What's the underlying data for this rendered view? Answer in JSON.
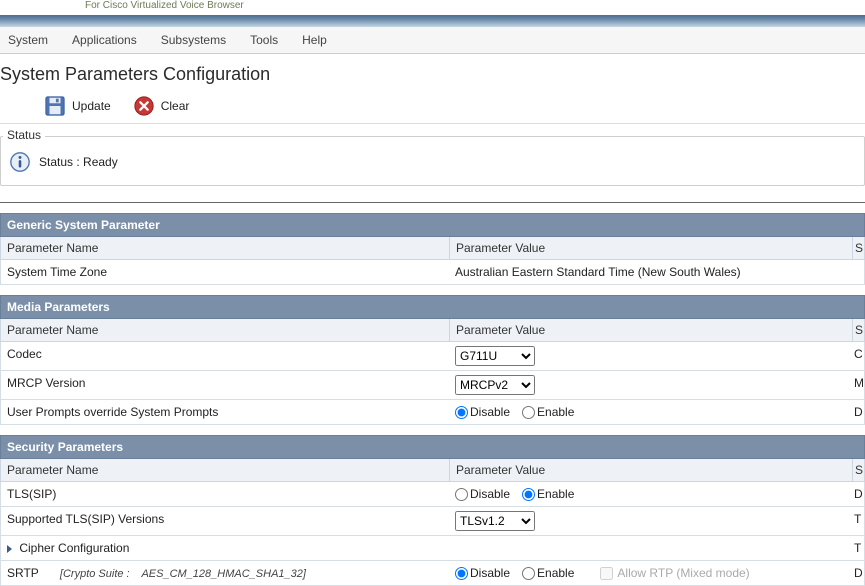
{
  "brand": "For Cisco Virtualized Voice Browser",
  "menu": [
    "System",
    "Applications",
    "Subsystems",
    "Tools",
    "Help"
  ],
  "page": {
    "title": "System Parameters Configuration"
  },
  "toolbar": {
    "update": "Update",
    "clear": "Clear"
  },
  "status": {
    "legend": "Status",
    "text": "Status : Ready"
  },
  "columns": {
    "name": "Parameter Name",
    "value": "Parameter Value",
    "s": "S"
  },
  "labels": {
    "disable": "Disable",
    "enable": "Enable"
  },
  "sections": {
    "generic": {
      "title": "Generic System Parameter",
      "timezone": {
        "label": "System Time Zone",
        "value": "Australian Eastern Standard Time (New South Wales)"
      }
    },
    "media": {
      "title": "Media Parameters",
      "codec": {
        "label": "Codec",
        "value": "G711U"
      },
      "mrcp": {
        "label": "MRCP Version",
        "value": "MRCPv2"
      },
      "override": {
        "label": "User Prompts override System Prompts",
        "value": "disable"
      }
    },
    "security": {
      "title": "Security Parameters",
      "tls": {
        "label": "TLS(SIP)",
        "value": "enable"
      },
      "tlsver": {
        "label": "Supported TLS(SIP) Versions",
        "value": "TLSv1.2"
      },
      "cipher": {
        "label": "Cipher Configuration"
      },
      "srtp": {
        "label": "SRTP",
        "crypto_prefix": "[Crypto Suite :",
        "crypto_value": "AES_CM_128_HMAC_SHA1_32]",
        "value": "disable",
        "mixed": "Allow RTP (Mixed mode)"
      }
    }
  }
}
